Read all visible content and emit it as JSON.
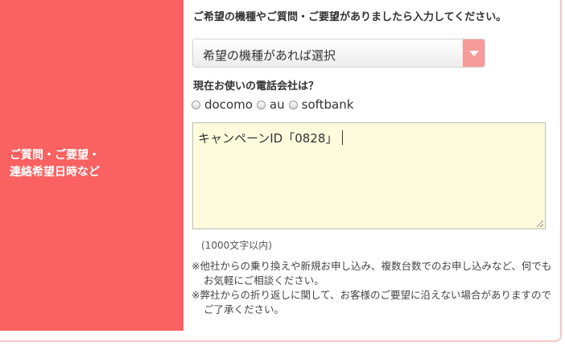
{
  "field": {
    "label": "ご質問・ご要望・\n連絡希望日時など"
  },
  "intro": "ご希望の機種やご質問・ご要望がありましたら入力してください。",
  "model_select": {
    "selected": "希望の機種があれば選択"
  },
  "carrier": {
    "question": "現在お使いの電話会社は？",
    "options": [
      "docomo",
      "au",
      "softbank"
    ]
  },
  "message": {
    "value": "キャンペーンID「0828」"
  },
  "char_limit": "(1000文字以内)",
  "notes": [
    "※他社からの乗り換えや新規お申し込み、複数台数でのお申し込みなど、何でもお気軽にご相談ください。",
    "※弊社からの折り返しに関して、お客様のご要望に沿えない場合がありますのでご了承ください。"
  ],
  "colors": {
    "label_bg": "#fa6161",
    "select_arrow": "#f79a9a",
    "textarea_bg": "#fdfbdc",
    "border_pink": "#f7c8c8"
  }
}
